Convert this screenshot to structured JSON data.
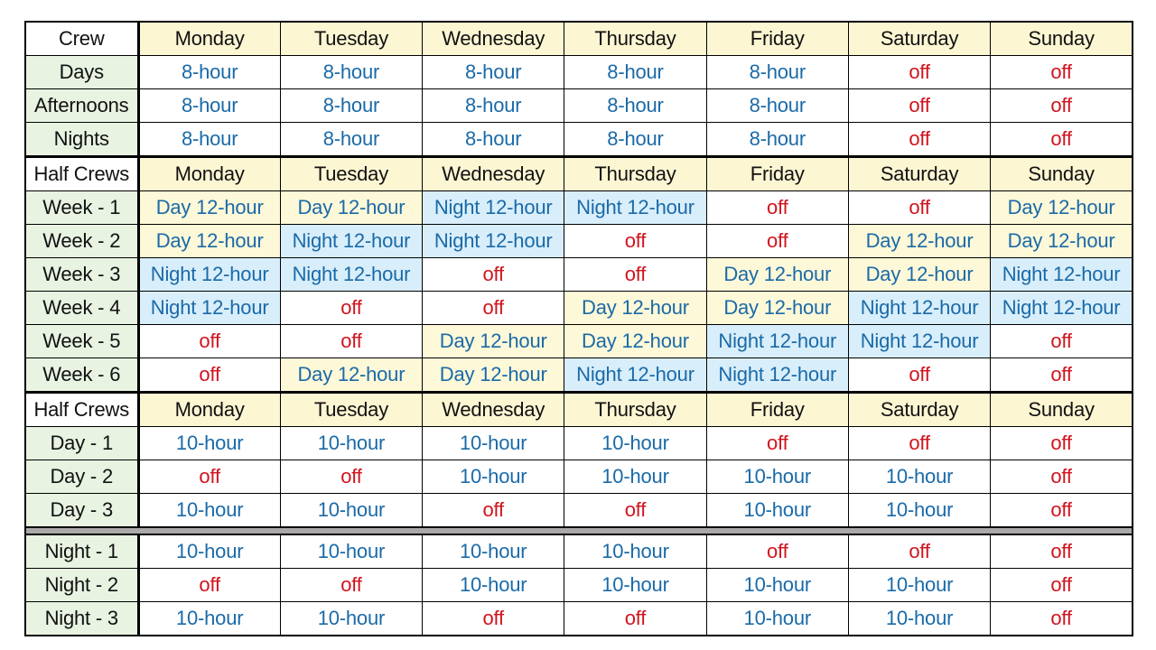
{
  "colors": {
    "work_text": "#1a6aa8",
    "off_text": "#d0141e",
    "day_shift_bg": "#fdf8d8",
    "night_shift_bg": "#d8eefa",
    "label_bg": "#e8f3e2",
    "header_bg": "#fdf6d3"
  },
  "days": [
    "Monday",
    "Tuesday",
    "Wednesday",
    "Thursday",
    "Friday",
    "Saturday",
    "Sunday"
  ],
  "sections": [
    {
      "header_label": "Crew",
      "rows": [
        {
          "label": "Days",
          "cells": [
            "8-hour",
            "8-hour",
            "8-hour",
            "8-hour",
            "8-hour",
            "off",
            "off"
          ]
        },
        {
          "label": "Afternoons",
          "cells": [
            "8-hour",
            "8-hour",
            "8-hour",
            "8-hour",
            "8-hour",
            "off",
            "off"
          ]
        },
        {
          "label": "Nights",
          "cells": [
            "8-hour",
            "8-hour",
            "8-hour",
            "8-hour",
            "8-hour",
            "off",
            "off"
          ]
        }
      ]
    },
    {
      "header_label": "Half Crews",
      "rows": [
        {
          "label": "Week - 1",
          "cells": [
            "Day 12-hour",
            "Day 12-hour",
            "Night 12-hour",
            "Night 12-hour",
            "off",
            "off",
            "Day 12-hour"
          ]
        },
        {
          "label": "Week - 2",
          "cells": [
            "Day 12-hour",
            "Night 12-hour",
            "Night 12-hour",
            "off",
            "off",
            "Day 12-hour",
            "Day 12-hour"
          ]
        },
        {
          "label": "Week - 3",
          "cells": [
            "Night 12-hour",
            "Night 12-hour",
            "off",
            "off",
            "Day 12-hour",
            "Day 12-hour",
            "Night 12-hour"
          ]
        },
        {
          "label": "Week - 4",
          "cells": [
            "Night 12-hour",
            "off",
            "off",
            "Day 12-hour",
            "Day 12-hour",
            "Night 12-hour",
            "Night 12-hour"
          ]
        },
        {
          "label": "Week - 5",
          "cells": [
            "off",
            "off",
            "Day 12-hour",
            "Day 12-hour",
            "Night 12-hour",
            "Night 12-hour",
            "off"
          ]
        },
        {
          "label": "Week - 6",
          "cells": [
            "off",
            "Day 12-hour",
            "Day 12-hour",
            "Night 12-hour",
            "Night 12-hour",
            "off",
            "off"
          ]
        }
      ]
    },
    {
      "header_label": "Half Crews",
      "rows": [
        {
          "label": "Day - 1",
          "cells": [
            "10-hour",
            "10-hour",
            "10-hour",
            "10-hour",
            "off",
            "off",
            "off"
          ]
        },
        {
          "label": "Day - 2",
          "cells": [
            "off",
            "off",
            "10-hour",
            "10-hour",
            "10-hour",
            "10-hour",
            "off"
          ]
        },
        {
          "label": "Day - 3",
          "cells": [
            "10-hour",
            "10-hour",
            "off",
            "off",
            "10-hour",
            "10-hour",
            "off"
          ]
        }
      ],
      "rows_after_separator": [
        {
          "label": "Night - 1",
          "cells": [
            "10-hour",
            "10-hour",
            "10-hour",
            "10-hour",
            "off",
            "off",
            "off"
          ]
        },
        {
          "label": "Night - 2",
          "cells": [
            "off",
            "off",
            "10-hour",
            "10-hour",
            "10-hour",
            "10-hour",
            "off"
          ]
        },
        {
          "label": "Night - 3",
          "cells": [
            "10-hour",
            "10-hour",
            "off",
            "off",
            "10-hour",
            "10-hour",
            "off"
          ]
        }
      ]
    }
  ]
}
